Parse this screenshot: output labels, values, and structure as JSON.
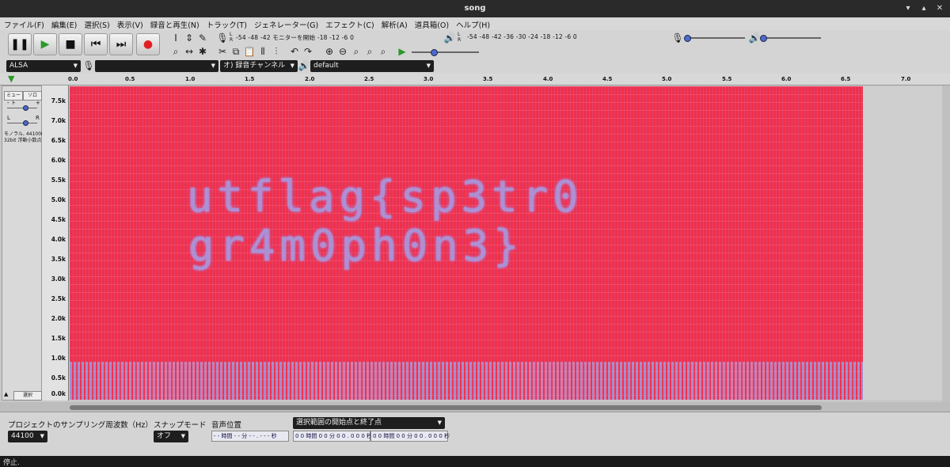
{
  "window": {
    "title": "song"
  },
  "menu": [
    "ファイル(F)",
    "編集(E)",
    "選択(S)",
    "表示(V)",
    "録音と再生(N)",
    "トラック(T)",
    "ジェネレーター(G)",
    "エフェクト(C)",
    "解析(A)",
    "道具箱(O)",
    "ヘルプ(H)"
  ],
  "meters": {
    "record_scale": "-54 -48 -42 モニターを開始 -18 -12 -6 0",
    "play_scale": "-54 -48 -42 -36 -30 -24 -18 -12 -6 0",
    "lr_top": "L",
    "lr_bottom": "R"
  },
  "device": {
    "host": "ALSA",
    "record_device": "",
    "channels": "オ) 録音チャンネル",
    "playback_device": "default"
  },
  "ruler": {
    "ticks": [
      "0.0",
      "0.5",
      "1.0",
      "1.5",
      "2.0",
      "2.5",
      "3.0",
      "3.5",
      "4.0",
      "4.5",
      "5.0",
      "5.5",
      "6.0",
      "6.5",
      "7.0"
    ]
  },
  "track": {
    "mute": "ミュート",
    "solo": "ソロ",
    "gain_minus": "-",
    "gain_plus": "+",
    "pan_l": "L",
    "pan_r": "R",
    "info_line1": "モノラル, 44100Hz",
    "info_line2": "32bit 浮動小数点",
    "select": "選択"
  },
  "yaxis": [
    "7.5k",
    "7.0k",
    "6.5k",
    "6.0k",
    "5.5k",
    "5.0k",
    "4.5k",
    "4.0k",
    "3.5k",
    "3.0k",
    "2.5k",
    "2.0k",
    "1.5k",
    "1.0k",
    "0.5k",
    "0.0k"
  ],
  "spectrogram": {
    "line1": "utflag{sp3tr0",
    "line2": "gr4m0ph0n3}"
  },
  "bottom": {
    "rate_label": "プロジェクトのサンプリング周波数（Hz）",
    "rate_value": "44100",
    "snap_label": "スナップモード",
    "snap_value": "オフ",
    "pos_label": "音声位置",
    "pos_value": "- - 時間 - - 分 - - . - - - 秒",
    "sel_mode": "選択範囲の開始点と終了点",
    "sel_start": "0 0 時間 0 0 分 0 0 . 0 0 0 秒",
    "sel_end": "0 0 時間 0 0 分 0 0 . 0 0 0 秒"
  },
  "status": "停止.",
  "colors": {
    "spectro_bg": "#f0304c",
    "spectro_text": "#a3a0e8",
    "accent": "#4a6ad0"
  }
}
